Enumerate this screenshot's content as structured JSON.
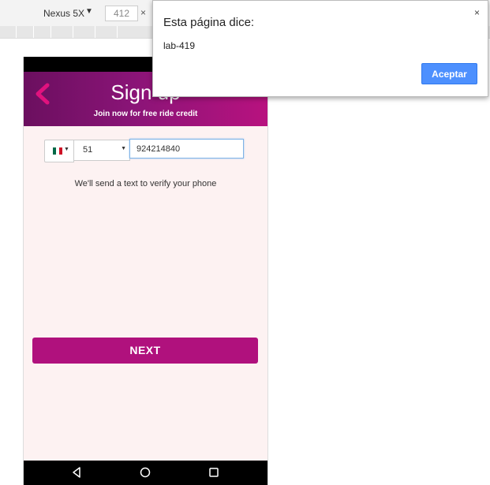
{
  "devtools": {
    "device_name": "Nexus 5X",
    "device_arrow": "▼",
    "width_value": "412",
    "times_symbol": "×"
  },
  "app": {
    "header": {
      "title": "Sign up",
      "subtitle": "Join now for free ride credit",
      "back_icon": "chevron-left-icon"
    },
    "phone": {
      "country_flag": "mexico-flag-icon",
      "country_code": "51",
      "number": "924214840"
    },
    "verify_text": "We'll send a text to verify your phone",
    "next_label": "NEXT",
    "colors": {
      "header_start": "#6b0f5f",
      "header_end": "#b8127f",
      "button": "#b0117d",
      "background": "#fdf2f2"
    }
  },
  "dialog": {
    "title": "Esta página dice:",
    "message": "lab-419",
    "ok_label": "Aceptar",
    "close_symbol": "×"
  }
}
